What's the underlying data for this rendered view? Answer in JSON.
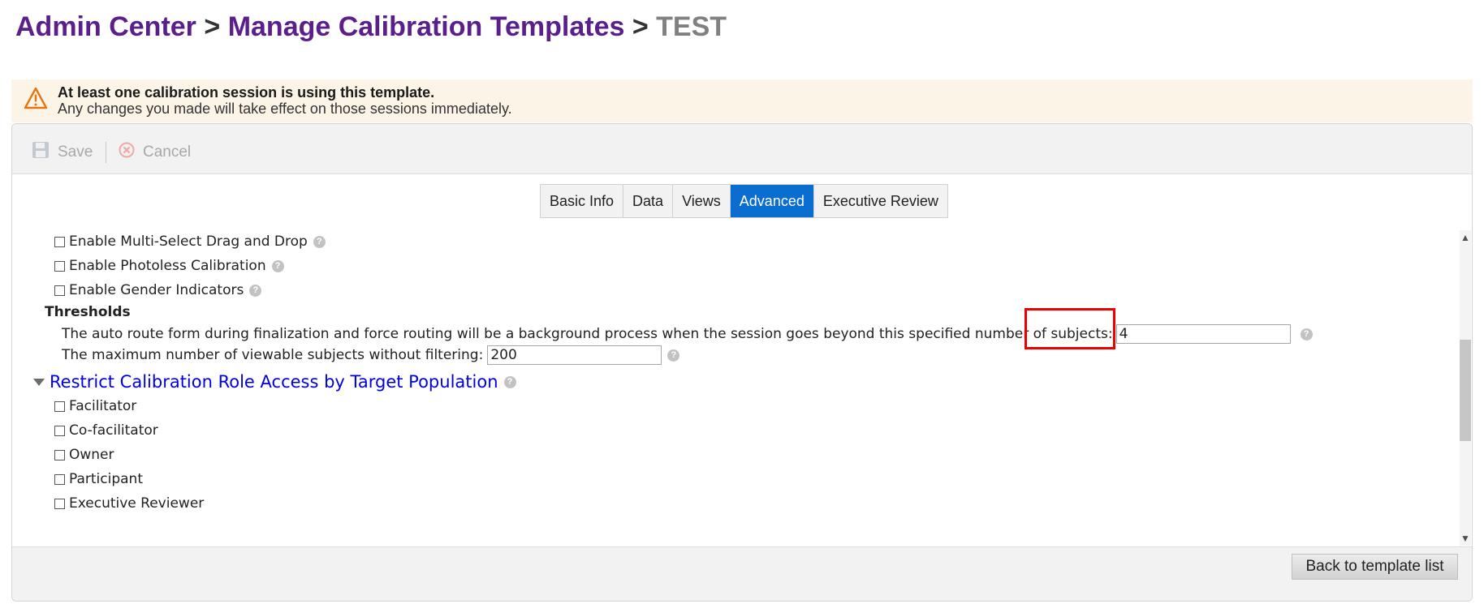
{
  "breadcrumb": {
    "admin_center": "Admin Center",
    "separator": ">",
    "manage_templates": "Manage Calibration Templates",
    "current": "TEST"
  },
  "warning": {
    "icon": "warning-triangle-icon",
    "title": "At least one calibration session is using this template.",
    "message": "Any changes you made will take effect on those sessions immediately."
  },
  "toolbar": {
    "save_label": "Save",
    "cancel_label": "Cancel",
    "save_icon": "floppy-disk-icon",
    "cancel_icon": "cancel-circle-icon"
  },
  "tabs": {
    "basic_info": "Basic Info",
    "data": "Data",
    "views": "Views",
    "advanced": "Advanced",
    "executive_review": "Executive Review",
    "active": "Advanced"
  },
  "options": {
    "multi_select": "Enable Multi-Select Drag and Drop",
    "photoless": "Enable Photoless Calibration",
    "gender": "Enable Gender Indicators"
  },
  "thresholds": {
    "title": "Thresholds",
    "auto_route_label": "The auto route form during finalization and force routing will be a background process when the session goes beyond this specified number of subjects:",
    "auto_route_value": "4",
    "max_viewable_label": "The maximum number of viewable subjects without filtering:",
    "max_viewable_value": "200"
  },
  "restrict_access": {
    "title": "Restrict Calibration Role Access by Target Population",
    "roles": {
      "facilitator": "Facilitator",
      "co_facilitator": "Co-facilitator",
      "owner": "Owner",
      "participant": "Participant",
      "executive_reviewer": "Executive Reviewer"
    }
  },
  "help_icon_glyph": "?",
  "footer": {
    "back_label": "Back to template list"
  },
  "colors": {
    "breadcrumb_link": "#5b1f8c",
    "tab_active": "#0a6ed1",
    "section_link": "#0000e0",
    "warning_bg": "#fdf4e8",
    "highlight": "#ee0000"
  }
}
